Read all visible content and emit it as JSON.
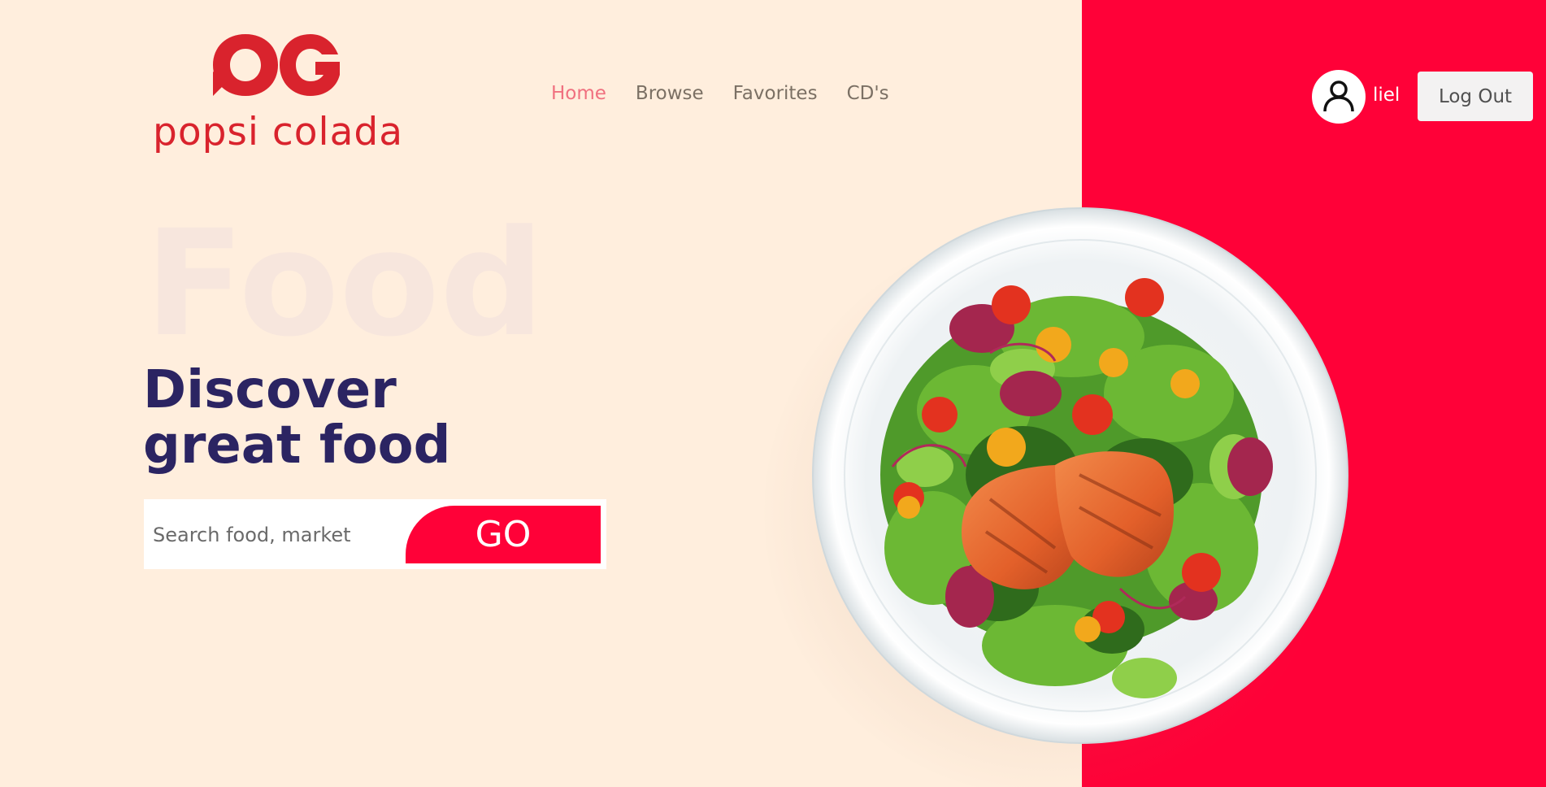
{
  "brand": {
    "name": "popsi colada",
    "color": "#d9232d"
  },
  "nav": {
    "items": [
      {
        "label": "Home",
        "active": true
      },
      {
        "label": "Browse",
        "active": false
      },
      {
        "label": "Favorites",
        "active": false
      },
      {
        "label": "CD's",
        "active": false
      }
    ]
  },
  "user": {
    "avatar_icon": "user-icon",
    "name": "liel",
    "logout_label": "Log Out"
  },
  "hero": {
    "background_word": "Food",
    "headline_line1": "Discover",
    "headline_line2": "great food",
    "search_placeholder": "Search food, market",
    "go_label": "GO"
  },
  "colors": {
    "background": "#ffeedd",
    "accent": "#ff0138",
    "headline": "#2b2462",
    "nav_active": "#f0707f",
    "nav_default": "#7b7064"
  },
  "image": {
    "plate_icon": "salmon-salad-plate-image"
  }
}
